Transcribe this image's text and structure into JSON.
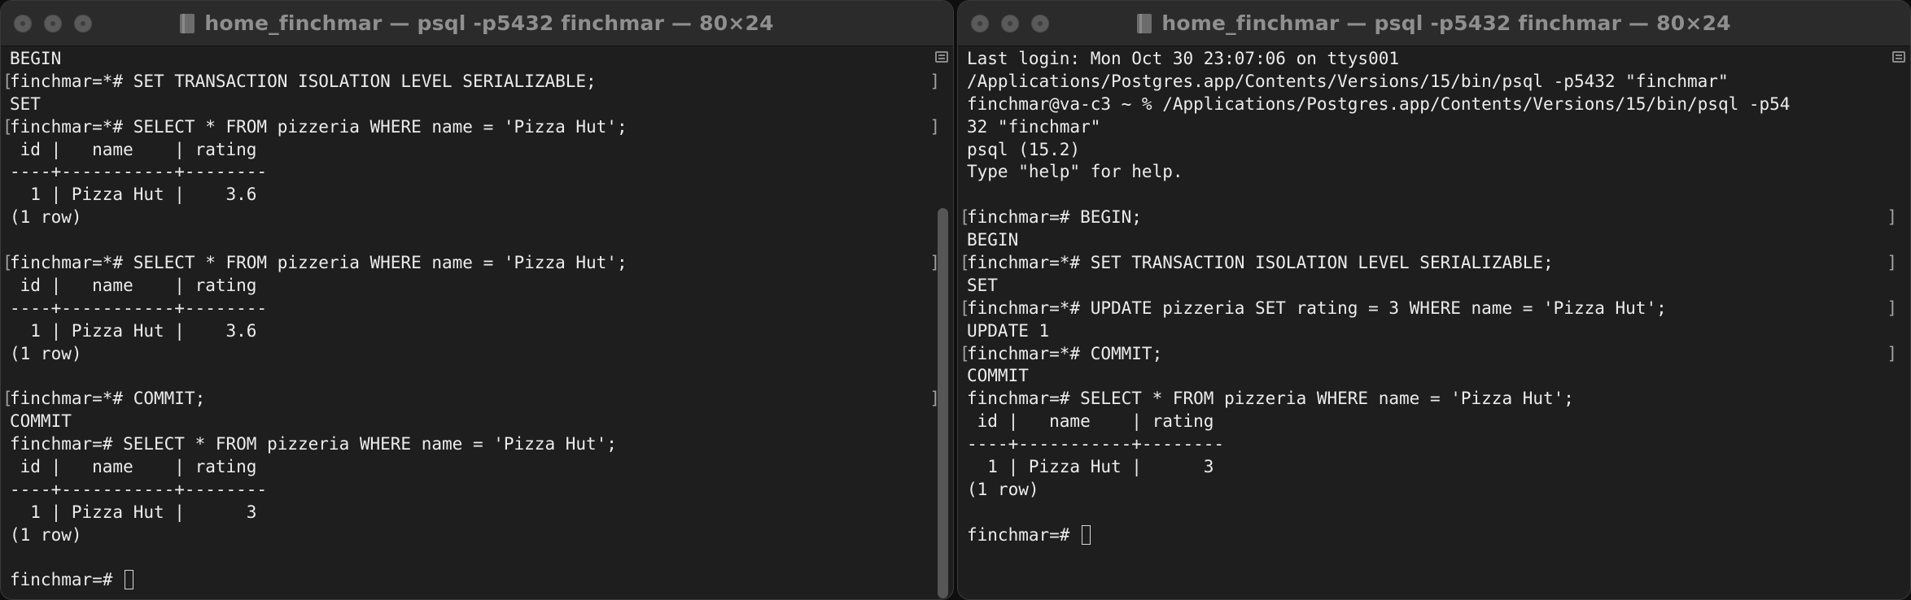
{
  "windows": [
    {
      "title": "home_finchmar — psql -p5432 finchmar — 80×24",
      "lines": [
        {
          "text": "BEGIN",
          "prompt": false
        },
        {
          "text": "finchmar=*# SET TRANSACTION ISOLATION LEVEL SERIALIZABLE;",
          "prompt": true
        },
        {
          "text": "SET",
          "prompt": false
        },
        {
          "text": "finchmar=*# SELECT * FROM pizzeria WHERE name = 'Pizza Hut';",
          "prompt": true
        },
        {
          "text": " id |   name    | rating",
          "prompt": false
        },
        {
          "text": "----+-----------+--------",
          "prompt": false
        },
        {
          "text": "  1 | Pizza Hut |    3.6",
          "prompt": false
        },
        {
          "text": "(1 row)",
          "prompt": false
        },
        {
          "text": "",
          "prompt": false
        },
        {
          "text": "finchmar=*# SELECT * FROM pizzeria WHERE name = 'Pizza Hut';",
          "prompt": true
        },
        {
          "text": " id |   name    | rating",
          "prompt": false
        },
        {
          "text": "----+-----------+--------",
          "prompt": false
        },
        {
          "text": "  1 | Pizza Hut |    3.6",
          "prompt": false
        },
        {
          "text": "(1 row)",
          "prompt": false
        },
        {
          "text": "",
          "prompt": false
        },
        {
          "text": "finchmar=*# COMMIT;",
          "prompt": true
        },
        {
          "text": "COMMIT",
          "prompt": false
        },
        {
          "text": "finchmar=# SELECT * FROM pizzeria WHERE name = 'Pizza Hut';",
          "prompt": false
        },
        {
          "text": " id |   name    | rating",
          "prompt": false
        },
        {
          "text": "----+-----------+--------",
          "prompt": false
        },
        {
          "text": "  1 | Pizza Hut |      3",
          "prompt": false
        },
        {
          "text": "(1 row)",
          "prompt": false
        },
        {
          "text": "",
          "prompt": false
        }
      ],
      "final_prompt": "finchmar=# "
    },
    {
      "title": "home_finchmar — psql -p5432 finchmar — 80×24",
      "lines": [
        {
          "text": "Last login: Mon Oct 30 23:07:06 on ttys001",
          "prompt": false
        },
        {
          "text": "/Applications/Postgres.app/Contents/Versions/15/bin/psql -p5432 \"finchmar\"",
          "prompt": false
        },
        {
          "text": "finchmar@va-c3 ~ % /Applications/Postgres.app/Contents/Versions/15/bin/psql -p54",
          "prompt": false
        },
        {
          "text": "32 \"finchmar\"",
          "prompt": false
        },
        {
          "text": "psql (15.2)",
          "prompt": false
        },
        {
          "text": "Type \"help\" for help.",
          "prompt": false
        },
        {
          "text": "",
          "prompt": false
        },
        {
          "text": "finchmar=# BEGIN;",
          "prompt": true
        },
        {
          "text": "BEGIN",
          "prompt": false
        },
        {
          "text": "finchmar=*# SET TRANSACTION ISOLATION LEVEL SERIALIZABLE;",
          "prompt": true
        },
        {
          "text": "SET",
          "prompt": false
        },
        {
          "text": "finchmar=*# UPDATE pizzeria SET rating = 3 WHERE name = 'Pizza Hut';",
          "prompt": true
        },
        {
          "text": "UPDATE 1",
          "prompt": false
        },
        {
          "text": "finchmar=*# COMMIT;",
          "prompt": true
        },
        {
          "text": "COMMIT",
          "prompt": false
        },
        {
          "text": "finchmar=# SELECT * FROM pizzeria WHERE name = 'Pizza Hut';",
          "prompt": false
        },
        {
          "text": " id |   name    | rating",
          "prompt": false
        },
        {
          "text": "----+-----------+--------",
          "prompt": false
        },
        {
          "text": "  1 | Pizza Hut |      3",
          "prompt": false
        },
        {
          "text": "(1 row)",
          "prompt": false
        },
        {
          "text": "",
          "prompt": false
        }
      ],
      "final_prompt": "finchmar=# "
    }
  ]
}
